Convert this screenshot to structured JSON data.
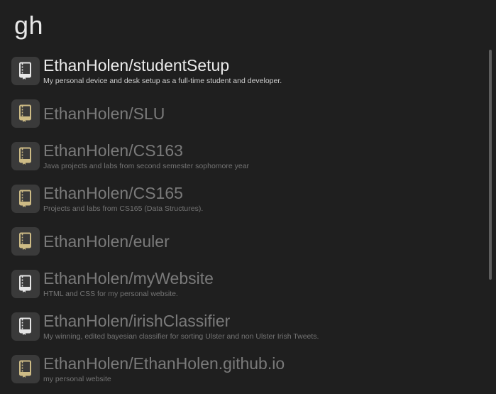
{
  "search": {
    "query": "gh"
  },
  "results": [
    {
      "title": "EthanHolen/studentSetup",
      "subtitle": "My personal device and desk setup as a full-time student and developer.",
      "icon": "book-icon",
      "icon_color": "#e6e6e6",
      "selected": true
    },
    {
      "title": "EthanHolen/SLU",
      "subtitle": "",
      "icon": "book-icon",
      "icon_color": "#cdbb85",
      "selected": false
    },
    {
      "title": "EthanHolen/CS163",
      "subtitle": "Java projects and labs from second semester sophomore year",
      "icon": "book-icon",
      "icon_color": "#cdbb85",
      "selected": false
    },
    {
      "title": "EthanHolen/CS165",
      "subtitle": "Projects and labs from CS165 (Data Structures).",
      "icon": "book-icon",
      "icon_color": "#cdbb85",
      "selected": false
    },
    {
      "title": "EthanHolen/euler",
      "subtitle": "",
      "icon": "book-icon",
      "icon_color": "#cdbb85",
      "selected": false
    },
    {
      "title": "EthanHolen/myWebsite",
      "subtitle": "HTML and CSS for my personal website.",
      "icon": "book-icon",
      "icon_color": "#e6e6e6",
      "selected": false
    },
    {
      "title": "EthanHolen/irishClassifier",
      "subtitle": "My winning, edited bayesian classifier for sorting Ulster and non Ulster Irish Tweets.",
      "icon": "book-icon",
      "icon_color": "#e6e6e6",
      "selected": false
    },
    {
      "title": "EthanHolen/EthanHolen.github.io",
      "subtitle": "my personal website",
      "icon": "book-icon",
      "icon_color": "#cdbb85",
      "selected": false
    }
  ],
  "colors": {
    "background": "#1f1f1f",
    "icon_tile": "#3a3a3a",
    "selected_text": "#ebebeb",
    "dim_text": "#7a7a7a"
  }
}
